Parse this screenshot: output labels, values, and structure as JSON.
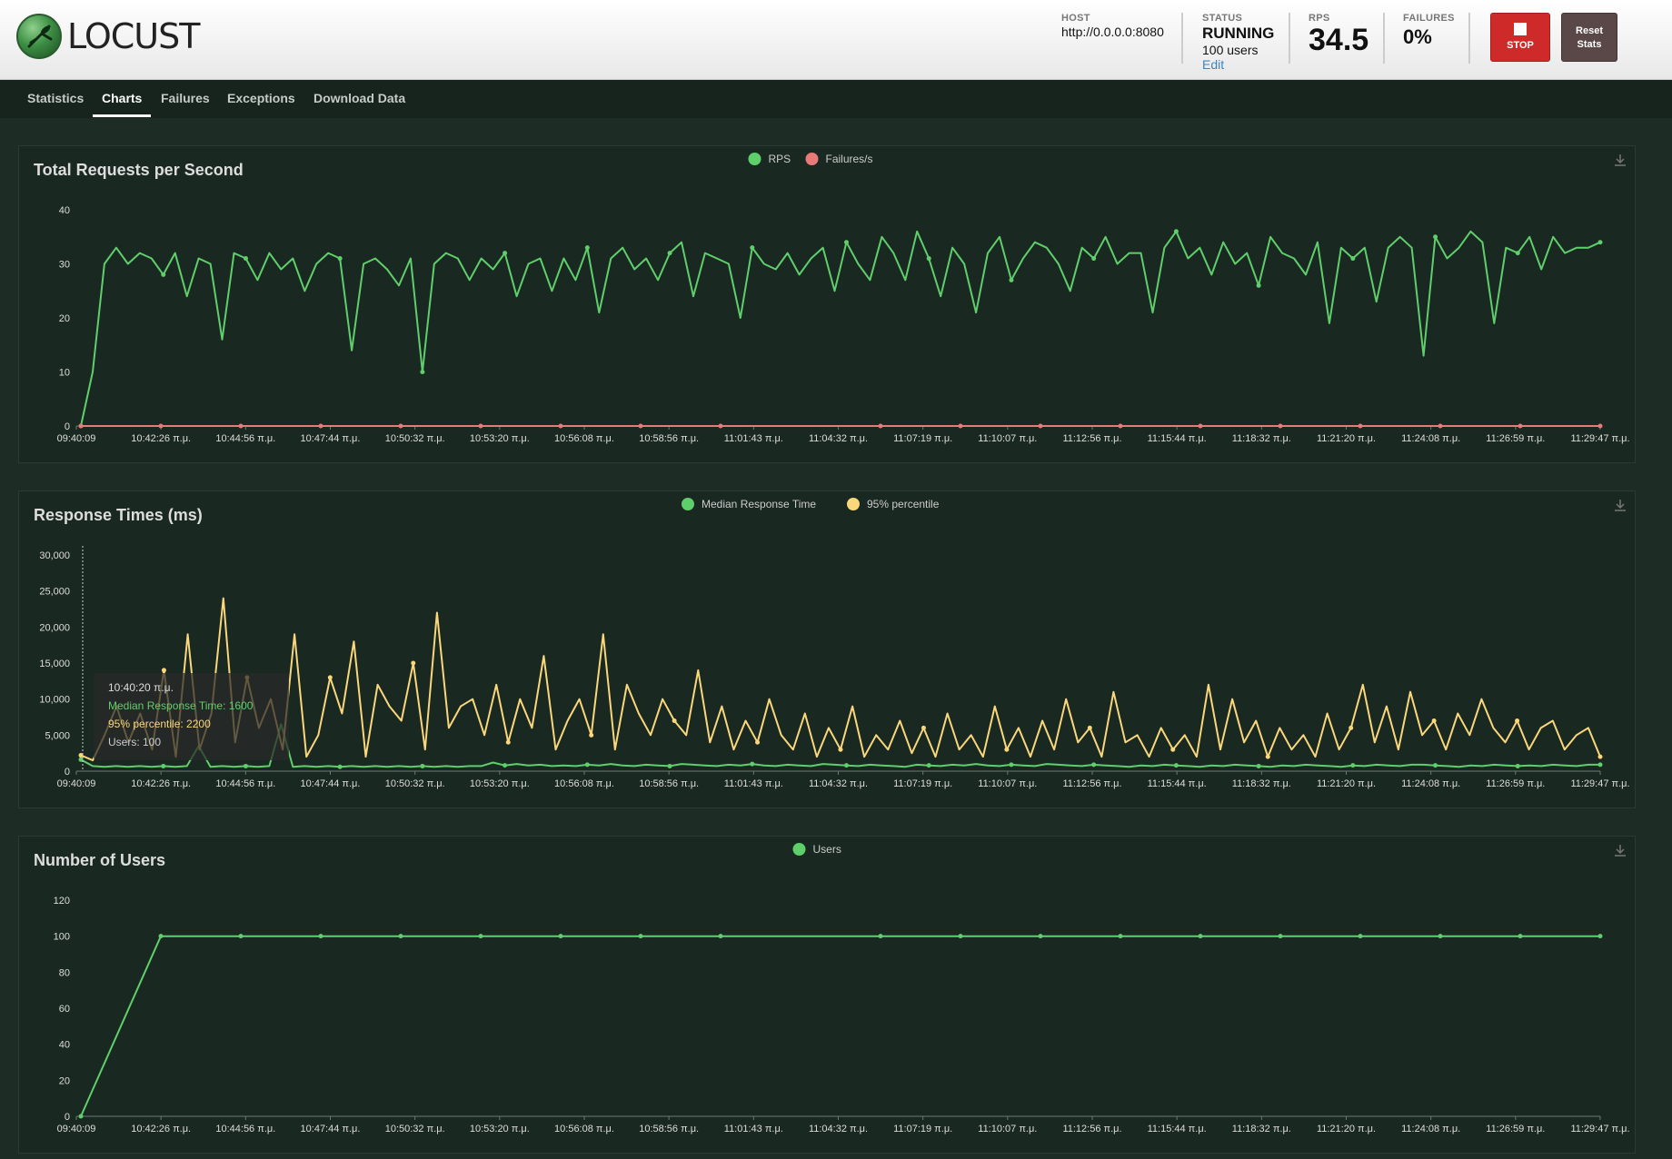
{
  "header": {
    "logo_text": "LOCUST",
    "host_label": "HOST",
    "host_value": "http://0.0.0.0:8080",
    "status_label": "STATUS",
    "status_value": "RUNNING",
    "users_value": "100 users",
    "edit_label": "Edit",
    "rps_label": "RPS",
    "rps_value": "34.5",
    "failures_label": "FAILURES",
    "failures_value": "0%",
    "stop_label": "STOP",
    "reset_label_1": "Reset",
    "reset_label_2": "Stats"
  },
  "tabs": [
    {
      "label": "Statistics"
    },
    {
      "label": "Charts"
    },
    {
      "label": "Failures"
    },
    {
      "label": "Exceptions"
    },
    {
      "label": "Download Data"
    }
  ],
  "active_tab": "Charts",
  "colors": {
    "green": "#5fcf6b",
    "red": "#e97a7a",
    "yellow": "#f9d77a",
    "panel_bg": "#1a2822",
    "axis": "#556"
  },
  "x_ticks": [
    "09:40:09",
    "10:42:26 π.μ.",
    "10:44:56 π.μ.",
    "10:47:44 π.μ.",
    "10:50:32 π.μ.",
    "10:53:20 π.μ.",
    "10:56:08 π.μ.",
    "10:58:56 π.μ.",
    "11:01:43 π.μ.",
    "11:04:32 π.μ.",
    "11:07:19 π.μ.",
    "11:10:07 π.μ.",
    "11:12:56 π.μ.",
    "11:15:44 π.μ.",
    "11:18:32 π.μ.",
    "11:21:20 π.μ.",
    "11:24:08 π.μ.",
    "11:26:59 π.μ.",
    "11:29:47 π.μ."
  ],
  "chart_data": [
    {
      "type": "line",
      "title": "Total Requests per Second",
      "ylim": [
        0,
        40
      ],
      "y_ticks": [
        "0",
        "10",
        "20",
        "30",
        "40"
      ],
      "legend": "top-center",
      "series": [
        {
          "name": "RPS",
          "color": "#5fcf6b",
          "values": [
            0,
            10,
            30,
            33,
            30,
            32,
            31,
            28,
            32,
            24,
            31,
            30,
            16,
            32,
            31,
            27,
            32,
            29,
            31,
            25,
            30,
            32,
            31,
            14,
            30,
            31,
            29,
            26,
            31,
            10,
            30,
            32,
            31,
            27,
            31,
            29,
            32,
            24,
            30,
            31,
            25,
            31,
            27,
            33,
            21,
            31,
            33,
            29,
            31,
            27,
            32,
            34,
            24,
            32,
            31,
            30,
            20,
            33,
            30,
            29,
            32,
            28,
            31,
            33,
            25,
            34,
            30,
            27,
            35,
            32,
            27,
            36,
            31,
            24,
            33,
            30,
            21,
            32,
            35,
            27,
            31,
            34,
            33,
            30,
            25,
            33,
            31,
            35,
            30,
            32,
            32,
            21,
            33,
            36,
            31,
            33,
            28,
            34,
            30,
            32,
            26,
            35,
            32,
            31,
            28,
            34,
            19,
            33,
            31,
            33,
            23,
            33,
            35,
            33,
            13,
            35,
            31,
            33,
            36,
            34,
            19,
            33,
            32,
            35,
            29,
            35,
            32,
            33,
            33,
            34
          ]
        },
        {
          "name": "Failures/s",
          "color": "#e97a7a",
          "values": [
            0,
            0,
            0,
            0,
            0,
            0,
            0,
            0,
            0,
            0,
            0,
            0,
            0,
            0,
            0,
            0,
            0,
            0,
            0,
            0
          ]
        }
      ]
    },
    {
      "type": "line",
      "title": "Response Times (ms)",
      "ylim": [
        0,
        30000
      ],
      "y_ticks": [
        "0",
        "5,000",
        "10,000",
        "15,000",
        "20,000",
        "25,000",
        "30,000"
      ],
      "legend": "top-center",
      "tooltip": {
        "time": "10:40:20 π.μ.",
        "median": "Median Response Time: 1600",
        "p95": "95% percentile: 2200",
        "users": "Users: 100"
      },
      "series": [
        {
          "name": "Median Response Time",
          "color": "#5fcf6b",
          "values": [
            1600,
            700,
            600,
            700,
            600,
            700,
            600,
            700,
            600,
            700,
            3500,
            600,
            700,
            600,
            700,
            600,
            700,
            6500,
            600,
            700,
            600,
            700,
            600,
            700,
            600,
            700,
            600,
            700,
            600,
            700,
            600,
            700,
            600,
            700,
            700,
            1200,
            800,
            1000,
            800,
            900,
            700,
            800,
            700,
            900,
            800,
            1000,
            800,
            700,
            900,
            800,
            700,
            1000,
            900,
            800,
            700,
            900,
            800,
            1000,
            800,
            700,
            900,
            800,
            700,
            1000,
            900,
            800,
            700,
            900,
            800,
            700,
            600,
            900,
            800,
            700,
            900,
            800,
            1000,
            800,
            700,
            900,
            800,
            700,
            1000,
            900,
            800,
            700,
            900,
            800,
            700,
            600,
            800,
            700,
            900,
            800,
            700,
            600,
            800,
            700,
            900,
            800,
            700,
            600,
            800,
            700,
            900,
            800,
            700,
            600,
            800,
            700,
            900,
            800,
            700,
            900,
            900,
            800,
            700,
            600,
            800,
            700,
            900,
            800,
            700,
            800,
            700,
            900,
            800,
            700,
            900,
            900
          ]
        },
        {
          "name": "95% percentile",
          "color": "#f9d77a",
          "values": [
            2200,
            1500,
            5000,
            9000,
            4000,
            8000,
            3000,
            14000,
            2000,
            19000,
            3000,
            8000,
            24000,
            4000,
            13000,
            6000,
            10000,
            3000,
            19000,
            2000,
            5000,
            13000,
            8000,
            18000,
            2000,
            12000,
            9000,
            7000,
            15000,
            3000,
            22000,
            6000,
            9000,
            10000,
            5000,
            12000,
            4000,
            10000,
            6000,
            16000,
            3000,
            7000,
            10000,
            5000,
            19000,
            3000,
            12000,
            8000,
            5000,
            10000,
            7000,
            5000,
            14000,
            4000,
            9000,
            3000,
            7000,
            4000,
            10000,
            5000,
            3000,
            8000,
            2000,
            6000,
            3000,
            9000,
            2000,
            5000,
            3000,
            7000,
            2500,
            6000,
            2000,
            8000,
            3000,
            5000,
            2000,
            9000,
            3000,
            6000,
            2000,
            7000,
            3000,
            10000,
            4000,
            6000,
            2000,
            11000,
            4000,
            5000,
            2000,
            6000,
            3000,
            5000,
            2000,
            12000,
            3000,
            10000,
            4000,
            7000,
            2000,
            6000,
            3000,
            5000,
            2000,
            8000,
            3000,
            6000,
            12000,
            4000,
            9000,
            3000,
            11000,
            5000,
            7000,
            3000,
            8000,
            5000,
            10000,
            6000,
            4000,
            7000,
            3000,
            6000,
            7000,
            3000,
            5000,
            6000,
            2000
          ]
        }
      ]
    },
    {
      "type": "line",
      "title": "Number of Users",
      "ylim": [
        0,
        120
      ],
      "y_ticks": [
        "0",
        "20",
        "40",
        "60",
        "80",
        "100",
        "120"
      ],
      "legend": "top-center",
      "series": [
        {
          "name": "Users",
          "color": "#5fcf6b",
          "values": [
            0,
            100,
            100,
            100,
            100,
            100,
            100,
            100,
            100,
            100,
            100,
            100,
            100,
            100,
            100,
            100,
            100,
            100,
            100,
            100
          ]
        }
      ]
    }
  ]
}
